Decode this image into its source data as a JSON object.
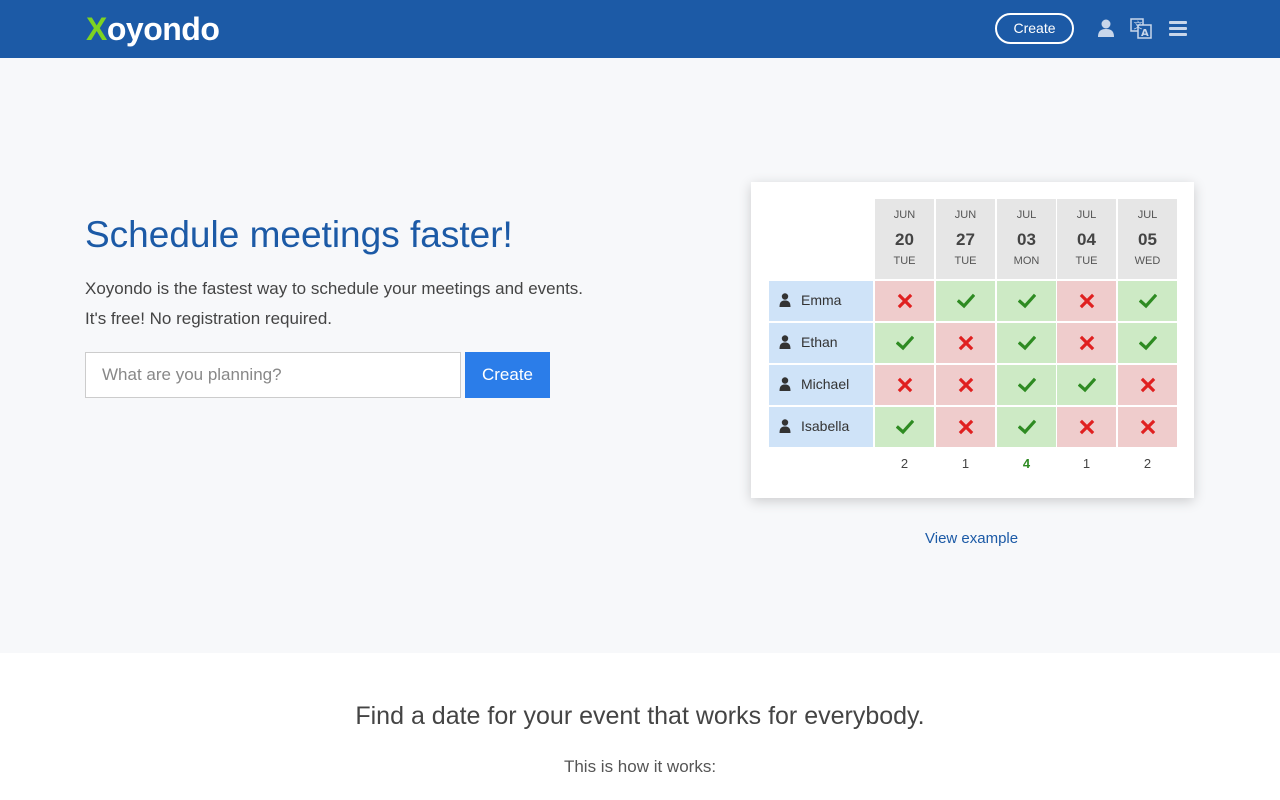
{
  "header": {
    "logo_first": "X",
    "logo_rest": "oyondo",
    "create_label": "Create",
    "icons": [
      "user-icon",
      "language-icon",
      "hamburger-menu-icon"
    ]
  },
  "hero": {
    "title": "Schedule meetings faster!",
    "desc_line1": "Xoyondo is the fastest way to schedule your meetings and events.",
    "desc_line2": "It's free! No registration required.",
    "input_placeholder": "What are you planning?",
    "create_label": "Create"
  },
  "example": {
    "dates": [
      {
        "mon": "JUN",
        "day": "20",
        "wd": "TUE"
      },
      {
        "mon": "JUN",
        "day": "27",
        "wd": "TUE"
      },
      {
        "mon": "JUL",
        "day": "03",
        "wd": "MON"
      },
      {
        "mon": "JUL",
        "day": "04",
        "wd": "TUE"
      },
      {
        "mon": "JUL",
        "day": "05",
        "wd": "WED"
      }
    ],
    "people": [
      {
        "name": "Emma",
        "votes": [
          "no",
          "yes",
          "yes",
          "no",
          "yes"
        ]
      },
      {
        "name": "Ethan",
        "votes": [
          "yes",
          "no",
          "yes",
          "no",
          "yes"
        ]
      },
      {
        "name": "Michael",
        "votes": [
          "no",
          "no",
          "yes",
          "yes",
          "no"
        ]
      },
      {
        "name": "Isabella",
        "votes": [
          "yes",
          "no",
          "yes",
          "no",
          "no"
        ]
      }
    ],
    "totals": [
      "2",
      "1",
      "4",
      "1",
      "2"
    ],
    "best_index": 2,
    "view_example_label": "View example"
  },
  "lower": {
    "title": "Find a date for your event that works for everybody.",
    "subtitle": "This is how it works:"
  },
  "colors": {
    "brand_blue": "#1c5aa6",
    "logo_green": "#7ed321",
    "button_blue": "#2b7de9",
    "yes_bg": "#cdeac5",
    "no_bg": "#efcccc",
    "yes_mark": "#2e8b22",
    "no_mark": "#e02020"
  }
}
